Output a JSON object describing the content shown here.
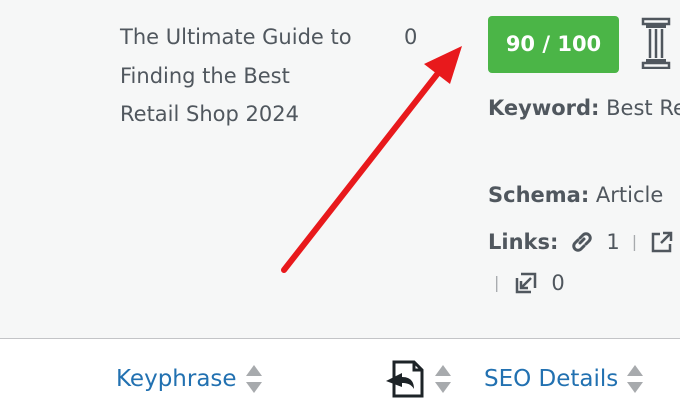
{
  "row": {
    "title": "The Ultimate Guide to Finding the Best Retail Shop 2024",
    "count": "0",
    "score": "90 / 100",
    "keyword_label": "Keyword:",
    "keyword_value": "Best Retail Shop",
    "schema_label": "Schema:",
    "schema_value": "Article",
    "links_label": "Links:",
    "internal_links": "1",
    "incoming_links": "0",
    "separator": "|"
  },
  "footer": {
    "col_keyphrase": "Keyphrase",
    "col_seo_details": "SEO Details"
  },
  "colors": {
    "score_green": "#4bb547",
    "link_blue": "#2271b1",
    "annotation_red": "#e8191c"
  },
  "icons": {
    "pillar": "pillar-content-icon",
    "link": "link-icon",
    "external": "external-link-icon",
    "incoming": "incoming-link-icon",
    "sort": "sort-arrows-icon",
    "schema_col": "schema-column-icon"
  }
}
